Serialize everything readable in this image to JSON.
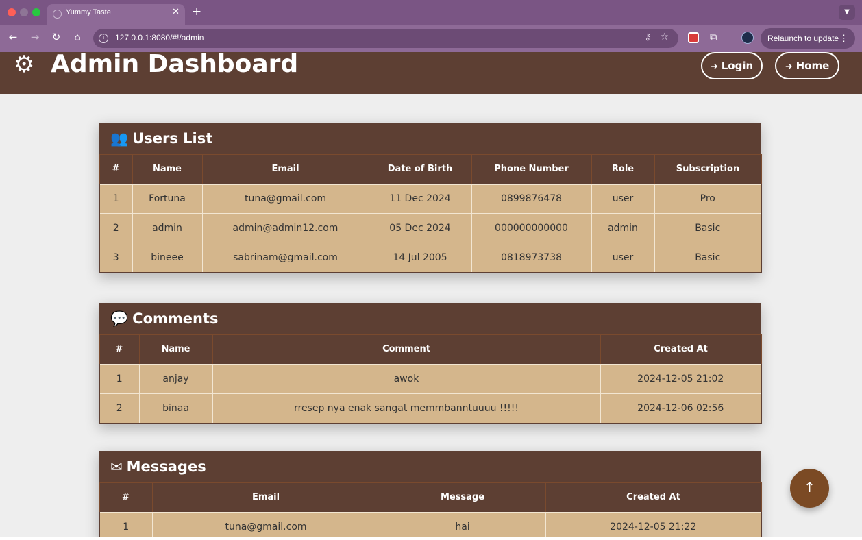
{
  "browser": {
    "tab_title": "Yummy Taste",
    "url": "127.0.0.1:8080/#!/admin",
    "relaunch_label": "Relaunch to update"
  },
  "header": {
    "title": "Admin Dashboard",
    "login_label": "Login",
    "home_label": "Home"
  },
  "users": {
    "title": "Users List",
    "columns": [
      "#",
      "Name",
      "Email",
      "Date of Birth",
      "Phone Number",
      "Role",
      "Subscription"
    ],
    "rows": [
      [
        "1",
        "Fortuna",
        "tuna@gmail.com",
        "11 Dec 2024",
        "0899876478",
        "user",
        "Pro"
      ],
      [
        "2",
        "admin",
        "admin@admin12.com",
        "05 Dec 2024",
        "000000000000",
        "admin",
        "Basic"
      ],
      [
        "3",
        "bineee",
        "sabrinam@gmail.com",
        "14 Jul 2005",
        "0818973738",
        "user",
        "Basic"
      ]
    ]
  },
  "comments": {
    "title": "Comments",
    "columns": [
      "#",
      "Name",
      "Comment",
      "Created At"
    ],
    "rows": [
      [
        "1",
        "anjay",
        "awok",
        "2024-12-05 21:02"
      ],
      [
        "2",
        "binaa",
        "rresep nya enak sangat memmbanntuuuu !!!!!",
        "2024-12-06 02:56"
      ]
    ]
  },
  "messages": {
    "title": "Messages",
    "columns": [
      "#",
      "Email",
      "Message",
      "Created At"
    ],
    "rows": [
      [
        "1",
        "tuna@gmail.com",
        "hai",
        "2024-12-05 21:22"
      ]
    ]
  },
  "colors": {
    "header_brown": "#5d3f33",
    "row_tan": "#d4b68c",
    "scroll_button": "#7b4a24"
  }
}
